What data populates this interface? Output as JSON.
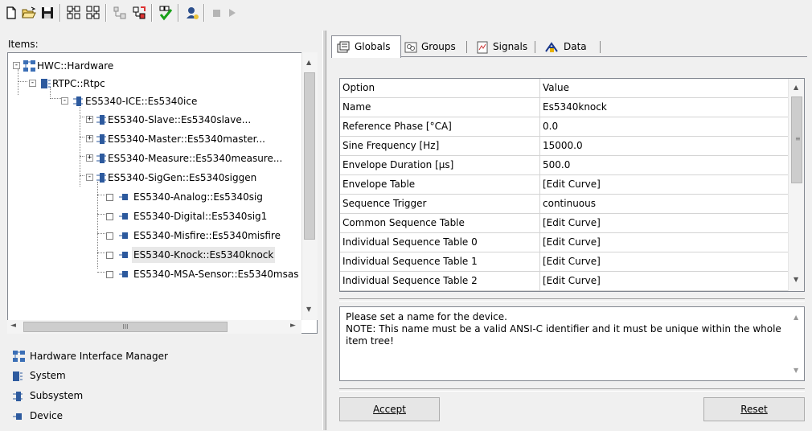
{
  "toolbar": {
    "buttons": [
      "new-file-icon",
      "open-folder-icon",
      "save-icon",
      "expand-tree-icon",
      "collapse-tree-icon",
      "move-item-icon",
      "insert-item-icon",
      "validate-icon",
      "user-icon",
      "stop-icon",
      "play-icon"
    ]
  },
  "left": {
    "items_label": "Items:",
    "tree": [
      {
        "label": "HWC::Hardware",
        "type": "hardware",
        "level": 0,
        "expander": "-"
      },
      {
        "label": "RTPC::Rtpc",
        "type": "system",
        "level": 1,
        "expander": "-"
      },
      {
        "label": "ES5340-ICE::Es5340ice",
        "type": "subsystem",
        "level": 2,
        "expander": "-"
      },
      {
        "label": "ES5340-Slave::Es5340slave...",
        "type": "subsystem",
        "level": 3,
        "expander": "+"
      },
      {
        "label": "ES5340-Master::Es5340master...",
        "type": "subsystem",
        "level": 3,
        "expander": "+"
      },
      {
        "label": "ES5340-Measure::Es5340measure...",
        "type": "subsystem",
        "level": 3,
        "expander": "+"
      },
      {
        "label": "ES5340-SigGen::Es5340siggen",
        "type": "subsystem",
        "level": 3,
        "expander": "-"
      },
      {
        "label": "ES5340-Analog::Es5340sig",
        "type": "device",
        "level": 4,
        "expander": ""
      },
      {
        "label": "ES5340-Digital::Es5340sig1",
        "type": "device",
        "level": 4,
        "expander": ""
      },
      {
        "label": "ES5340-Misfire::Es5340misfire",
        "type": "device",
        "level": 4,
        "expander": ""
      },
      {
        "label": "ES5340-Knock::Es5340knock",
        "type": "device",
        "level": 4,
        "expander": "",
        "selected": true
      },
      {
        "label": "ES5340-MSA-Sensor::Es5340msas",
        "type": "device",
        "level": 4,
        "expander": ""
      }
    ],
    "hscroll_grip": "III",
    "legend": [
      {
        "label": "Hardware Interface Manager",
        "icon": "hardware-icon"
      },
      {
        "label": "System",
        "icon": "system-icon"
      },
      {
        "label": "Subsystem",
        "icon": "subsystem-icon"
      },
      {
        "label": "Device",
        "icon": "device-icon"
      }
    ]
  },
  "tabs": [
    {
      "label": "Globals",
      "icon": "globals-tab-icon",
      "active": true
    },
    {
      "label": "Groups",
      "icon": "groups-tab-icon"
    },
    {
      "label": "Signals",
      "icon": "signals-tab-icon"
    },
    {
      "label": "Data",
      "icon": "data-tab-icon"
    }
  ],
  "grid": {
    "headers": [
      "Option",
      "Value"
    ],
    "rows": [
      [
        "Name",
        "Es5340knock"
      ],
      [
        "Reference Phase [°CA]",
        "0.0"
      ],
      [
        "Sine Frequency [Hz]",
        "15000.0"
      ],
      [
        "Envelope Duration [µs]",
        "500.0"
      ],
      [
        "Envelope Table",
        "[Edit Curve]"
      ],
      [
        "Sequence Trigger",
        "continuous"
      ],
      [
        "Common Sequence Table",
        "[Edit Curve]"
      ],
      [
        "Individual Sequence Table 0",
        "[Edit Curve]"
      ],
      [
        "Individual Sequence Table 1",
        "[Edit Curve]"
      ],
      [
        "Individual Sequence Table 2",
        "[Edit Curve]"
      ]
    ]
  },
  "description": {
    "line1": "Please set a name for the device.",
    "line2": "NOTE: This name must be a valid ANSI-C identifier and it must be unique within the whole item tree!"
  },
  "buttons": {
    "accept": "Accept",
    "reset": "Reset"
  },
  "colors": {
    "background": "#f0f0f0",
    "selected_row": "#f0f0f0",
    "grid_line": "#d4d4d4"
  }
}
